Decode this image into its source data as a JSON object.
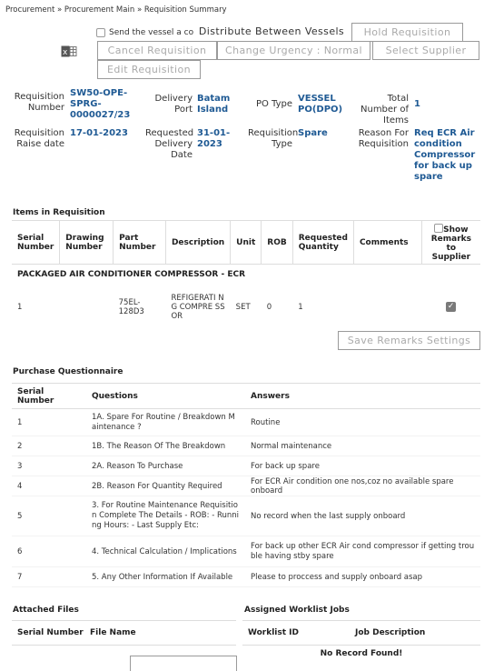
{
  "breadcrumb": {
    "item1": "Procurement",
    "item2": "Procurement Main",
    "item3": "Requisition Summary",
    "sep": "»"
  },
  "actions": {
    "send_copy": "Send the vessel a copy",
    "distribute": "Distribute Between Vessels",
    "hold": "Hold Requisition",
    "cancel": "Cancel Requisition",
    "change_urgency": "Change Urgency : Normal",
    "select_supplier": "Select Supplier",
    "edit": "Edit Requisition"
  },
  "summary": {
    "req_number_label": "Requisition Number",
    "req_number": "SW50-OPE-SPRG-0000027/23",
    "delivery_port_label": "Delivery Port",
    "delivery_port": "Batam Island",
    "po_type_label": "PO Type",
    "po_type": "VESSEL PO(DPO)",
    "total_items_label": "Total Number of Items",
    "total_items": "1",
    "raise_date_label": "Requisition Raise date",
    "raise_date": "17-01-2023",
    "req_delivery_label": "Requested Delivery Date",
    "req_delivery": "31-01-2023",
    "req_type_label": "Requisition Type",
    "req_type": "Spare",
    "reason_label": "Reason For Requisition",
    "reason": "Req ECR Air condition Compressor for back up spare"
  },
  "items_section": {
    "title": "Items in Requisition",
    "headers": {
      "serial": "Serial Number",
      "drawing": "Drawing Number",
      "part": "Part Number",
      "desc": "Description",
      "unit": "Unit",
      "rob": "ROB",
      "qty": "Requested Quantity",
      "comments": "Comments",
      "show": "Show Remarks to Supplier"
    },
    "group": "PACKAGED AIR CONDITIONER COMPRESSOR - ECR",
    "row": {
      "serial": "1",
      "drawing": "",
      "part": "75EL-128D3",
      "desc": "REFIGERATI NG COMPRE SSOR",
      "unit": "SET",
      "rob": "0",
      "qty": "1",
      "comments": ""
    },
    "save_btn": "Save Remarks Settings"
  },
  "questionnaire": {
    "title": "Purchase Questionnaire",
    "headers": {
      "serial": "Serial Number",
      "question": "Questions",
      "answer": "Answers"
    },
    "rows": [
      {
        "n": "1",
        "q": "1A. Spare For Routine / Breakdown Maintenance ?",
        "a": "Routine"
      },
      {
        "n": "2",
        "q": "1B. The Reason Of The Breakdown",
        "a": "Normal maintenance"
      },
      {
        "n": "3",
        "q": "2A. Reason To Purchase",
        "a": "For back up spare"
      },
      {
        "n": "4",
        "q": "2B. Reason For Quantity Required",
        "a": "For ECR Air condition one nos,coz no available spare onboard"
      },
      {
        "n": "5",
        "q": "3. For Routine Maintenance Requisition Complete The Details - ROB: - Running Hours: - Last Supply Etc:",
        "a": "No record when the last supply onboard"
      },
      {
        "n": "6",
        "q": "4. Technical Calculation / Implications",
        "a": "For back up other ECR Air cond compressor if getting trouble having stby spare"
      },
      {
        "n": "7",
        "q": "5. Any Other Information If Available",
        "a": "Please to proccess and supply onboard asap"
      }
    ]
  },
  "attached": {
    "title": "Attached Files",
    "serial": "Serial Number",
    "file": "File Name"
  },
  "worklist": {
    "title": "Assigned Worklist Jobs",
    "id": "Worklist ID",
    "desc": "Job Description",
    "empty": "No Record Found!"
  }
}
